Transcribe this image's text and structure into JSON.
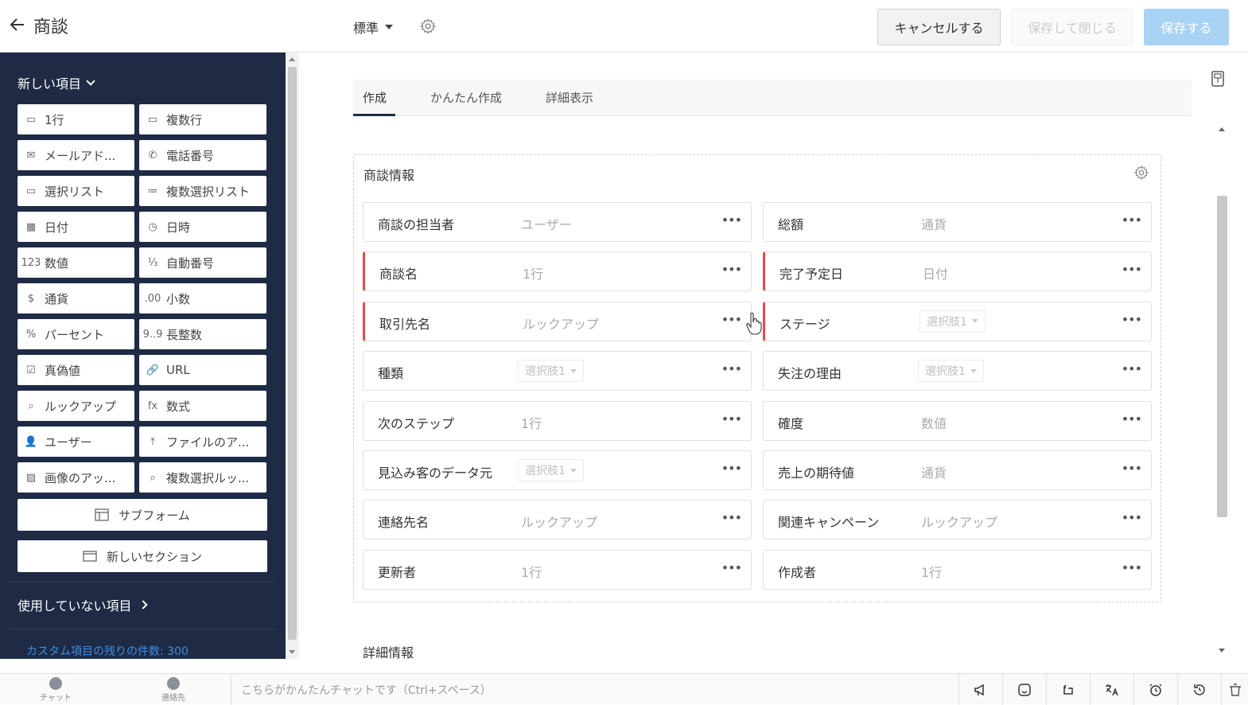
{
  "header": {
    "title": "商談",
    "layout_name": "標準",
    "cancel_label": "キャンセルする",
    "save_close_label": "保存して閉じる",
    "save_label": "保存する"
  },
  "sidebar": {
    "new_items_label": "新しい項目",
    "field_types": [
      {
        "label": "1行",
        "icon": "single-line-icon"
      },
      {
        "label": "複数行",
        "icon": "multi-line-icon"
      },
      {
        "label": "メールアド...",
        "icon": "mail-icon"
      },
      {
        "label": "電話番号",
        "icon": "phone-icon"
      },
      {
        "label": "選択リスト",
        "icon": "picklist-icon"
      },
      {
        "label": "複数選択リスト",
        "icon": "multi-picklist-icon"
      },
      {
        "label": "日付",
        "icon": "calendar-icon"
      },
      {
        "label": "日時",
        "icon": "datetime-icon"
      },
      {
        "label": "数値",
        "icon": "number-icon"
      },
      {
        "label": "自動番号",
        "icon": "auto-number-icon"
      },
      {
        "label": "通貨",
        "icon": "currency-icon"
      },
      {
        "label": "小数",
        "icon": "decimal-icon"
      },
      {
        "label": "パーセント",
        "icon": "percent-icon"
      },
      {
        "label": "長整数",
        "icon": "long-integer-icon"
      },
      {
        "label": "真偽値",
        "icon": "checkbox-icon"
      },
      {
        "label": "URL",
        "icon": "link-icon"
      },
      {
        "label": "ルックアップ",
        "icon": "lookup-icon"
      },
      {
        "label": "数式",
        "icon": "formula-icon"
      },
      {
        "label": "ユーザー",
        "icon": "user-icon"
      },
      {
        "label": "ファイルのア...",
        "icon": "upload-icon"
      },
      {
        "label": "画像のアッ...",
        "icon": "image-icon"
      },
      {
        "label": "複数選択ルッ...",
        "icon": "multi-lookup-icon"
      }
    ],
    "field_type_glyphs": [
      "▭",
      "▭",
      "✉",
      "✆",
      "▭",
      "≔",
      "▦",
      "◷",
      "123",
      "⅓",
      "$",
      ".00",
      "%",
      "9..9",
      "☑",
      "🔗",
      "⌕",
      "fx",
      "👤",
      "⤒",
      "▨",
      "⌕"
    ],
    "subform_label": "サブフォーム",
    "new_section_label": "新しいセクション",
    "unused_items_label": "使用していない項目",
    "custom_remaining": "カスタム項目の残りの件数: 300"
  },
  "tabs": [
    {
      "label": "作成"
    },
    {
      "label": "かんたん作成"
    },
    {
      "label": "詳細表示"
    }
  ],
  "section": {
    "title": "商談情報",
    "rows": [
      {
        "left": {
          "label": "商談の担当者",
          "type": "ユーザー",
          "required": false,
          "select": false
        },
        "right": {
          "label": "総額",
          "type": "通貨",
          "required": false,
          "select": false
        }
      },
      {
        "left": {
          "label": "商談名",
          "type": "1行",
          "required": true,
          "select": false
        },
        "right": {
          "label": "完了予定日",
          "type": "日付",
          "required": true,
          "select": false
        }
      },
      {
        "left": {
          "label": "取引先名",
          "type": "ルックアップ",
          "required": true,
          "select": false
        },
        "right": {
          "label": "ステージ",
          "type": "選択肢1",
          "required": true,
          "select": true
        }
      },
      {
        "left": {
          "label": "種類",
          "type": "選択肢1",
          "required": false,
          "select": true
        },
        "right": {
          "label": "失注の理由",
          "type": "選択肢1",
          "required": false,
          "select": true
        }
      },
      {
        "left": {
          "label": "次のステップ",
          "type": "1行",
          "required": false,
          "select": false
        },
        "right": {
          "label": "確度",
          "type": "数値",
          "required": false,
          "select": false
        }
      },
      {
        "left": {
          "label": "見込み客のデータ元",
          "type": "選択肢1",
          "required": false,
          "select": true
        },
        "right": {
          "label": "売上の期待値",
          "type": "通貨",
          "required": false,
          "select": false
        }
      },
      {
        "left": {
          "label": "連絡先名",
          "type": "ルックアップ",
          "required": false,
          "select": false
        },
        "right": {
          "label": "関連キャンペーン",
          "type": "ルックアップ",
          "required": false,
          "select": false
        }
      },
      {
        "left": {
          "label": "更新者",
          "type": "1行",
          "required": false,
          "select": false
        },
        "right": {
          "label": "作成者",
          "type": "1行",
          "required": false,
          "select": false
        }
      }
    ],
    "more_label": "•••"
  },
  "detail_section_title": "詳細情報",
  "bottombar": {
    "chat_label": "チャット",
    "contacts_label": "連絡先",
    "chat_placeholder": "こちらがかんたんチャットです（Ctrl+スペース）"
  },
  "colors": {
    "sidebar_bg": "#1f2a44",
    "required_marker": "#e44a4a",
    "save_button": "#a9d3f5",
    "link_blue": "#3a8ee6"
  }
}
